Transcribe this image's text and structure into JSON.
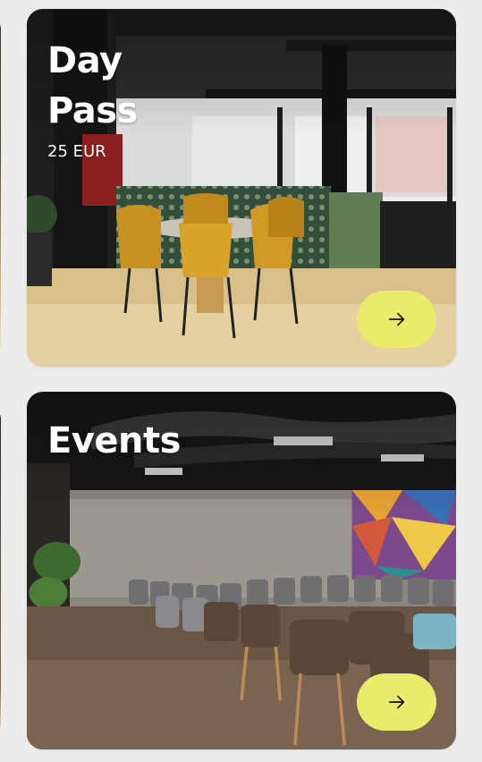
{
  "cards": [
    {
      "title_line1": "Day",
      "title_line2": "Pass",
      "price": "25 EUR",
      "arrow_icon": "arrow-right-icon"
    },
    {
      "title": "Events",
      "arrow_icon": "arrow-right-icon"
    }
  ],
  "colors": {
    "button_accent": "#e8ec6a",
    "page_background": "#ececec",
    "title_text": "#ffffff"
  }
}
